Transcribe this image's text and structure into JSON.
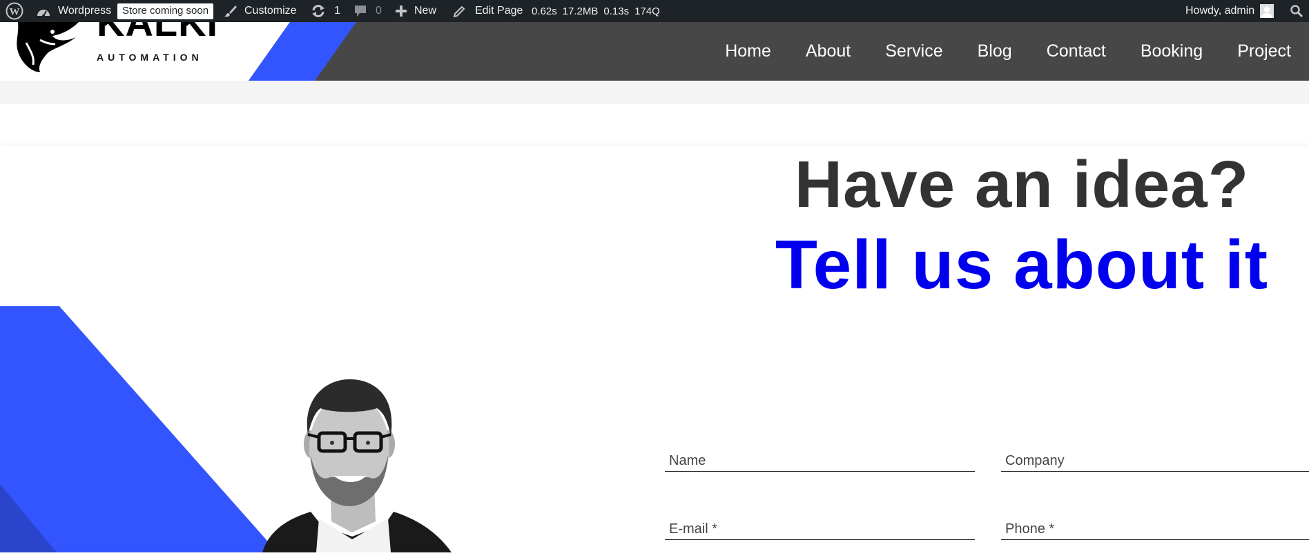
{
  "adminbar": {
    "site_name": "Wordpress",
    "store_badge": "Store coming soon",
    "customize": "Customize",
    "updates_count": "1",
    "comments_count": "0",
    "new_label": "New",
    "edit_page": "Edit Page",
    "stats": {
      "time1": "0.62s",
      "memory": "17.2MB",
      "time2": "0.13s",
      "queries": "174Q"
    },
    "howdy": "Howdy, admin"
  },
  "brand": {
    "name": "KALKI",
    "tagline": "AUTOMATION",
    "accent_color": "#3355ff"
  },
  "nav": {
    "items": [
      "Home",
      "About",
      "Service",
      "Blog",
      "Contact",
      "Booking",
      "Project"
    ]
  },
  "hero": {
    "line1": "Have an idea?",
    "line2": "Tell us about it",
    "line1_color": "#333333",
    "line2_color": "#0000ee"
  },
  "form": {
    "name_placeholder": "Name",
    "company_placeholder": "Company",
    "email_placeholder": "E-mail *",
    "phone_placeholder": "Phone *"
  }
}
